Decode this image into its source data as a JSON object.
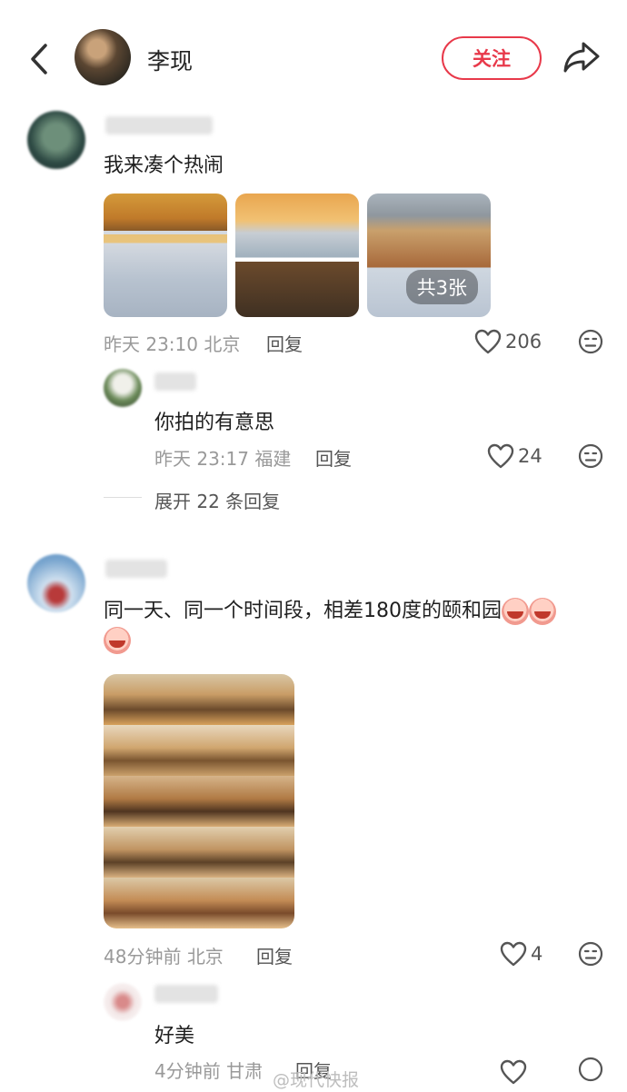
{
  "header": {
    "name": "李现",
    "follow_label": "关注"
  },
  "comments": [
    {
      "text": "我来凑个热闹",
      "images_badge": "共3张",
      "time": "昨天 23:10",
      "location": "北京",
      "reply_label": "回复",
      "likes": "206",
      "replies": [
        {
          "text": "你拍的有意思",
          "time": "昨天 23:17",
          "location": "福建",
          "reply_label": "回复",
          "likes": "24"
        }
      ],
      "expand_label": "展开 22 条回复"
    },
    {
      "text": "同一天、同一个时间段，相差180度的颐和园",
      "time": "48分钟前",
      "location": "北京",
      "reply_label": "回复",
      "likes": "4",
      "replies": [
        {
          "text": "好美",
          "time": "4分钟前",
          "location": "甘肃",
          "reply_label": "回复"
        }
      ]
    }
  ],
  "watermark": "@现代快报",
  "colors": {
    "accent": "#e8394a",
    "meta": "#999999"
  }
}
